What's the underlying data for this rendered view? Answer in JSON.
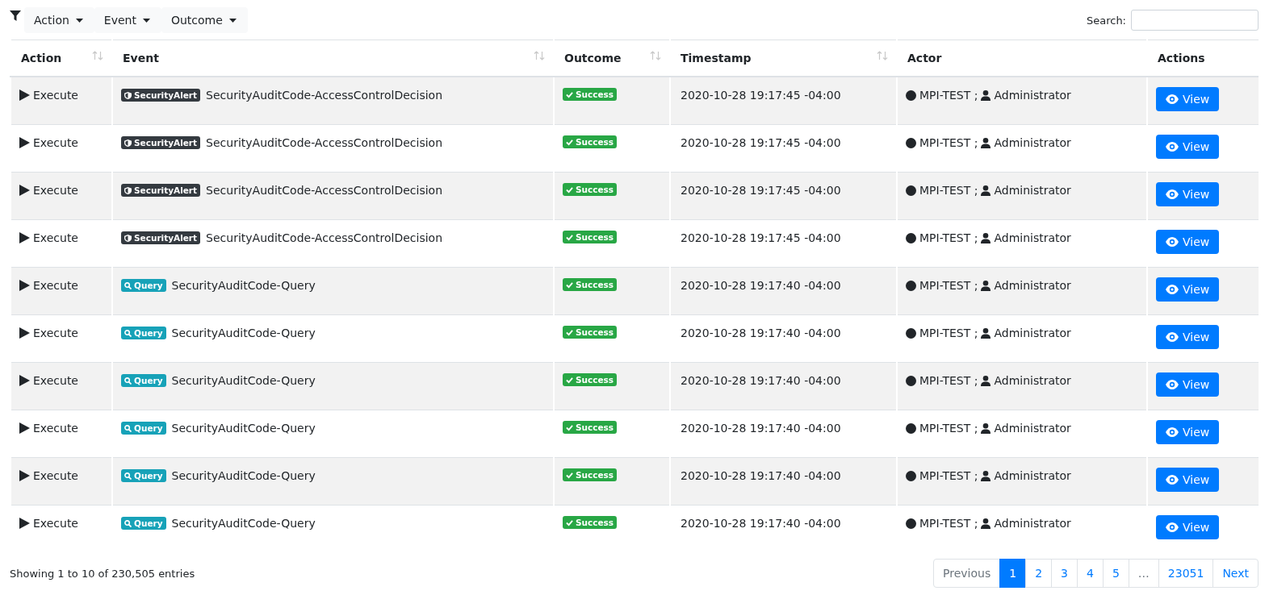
{
  "filters": [
    {
      "label": "Action"
    },
    {
      "label": "Event"
    },
    {
      "label": "Outcome"
    }
  ],
  "search": {
    "label": "Search:"
  },
  "table": {
    "columns": [
      {
        "label": "Action",
        "sortable": true
      },
      {
        "label": "Event",
        "sortable": true
      },
      {
        "label": "Outcome",
        "sortable": true
      },
      {
        "label": "Timestamp",
        "sortable": true
      },
      {
        "label": "Actor",
        "sortable": false
      },
      {
        "label": "Actions",
        "sortable": false
      }
    ],
    "rows": [
      {
        "action": "Execute",
        "badge": {
          "kind": "alert",
          "label": "SecurityAlert"
        },
        "event": "SecurityAuditCode-AccessControlDecision",
        "outcome": "Success",
        "timestamp": "2020-10-28 19:17:45 -04:00",
        "device": "MPI-TEST ;",
        "user": "Administrator",
        "button": "View"
      },
      {
        "action": "Execute",
        "badge": {
          "kind": "alert",
          "label": "SecurityAlert"
        },
        "event": "SecurityAuditCode-AccessControlDecision",
        "outcome": "Success",
        "timestamp": "2020-10-28 19:17:45 -04:00",
        "device": "MPI-TEST ;",
        "user": "Administrator",
        "button": "View"
      },
      {
        "action": "Execute",
        "badge": {
          "kind": "alert",
          "label": "SecurityAlert"
        },
        "event": "SecurityAuditCode-AccessControlDecision",
        "outcome": "Success",
        "timestamp": "2020-10-28 19:17:45 -04:00",
        "device": "MPI-TEST ;",
        "user": "Administrator",
        "button": "View"
      },
      {
        "action": "Execute",
        "badge": {
          "kind": "alert",
          "label": "SecurityAlert"
        },
        "event": "SecurityAuditCode-AccessControlDecision",
        "outcome": "Success",
        "timestamp": "2020-10-28 19:17:45 -04:00",
        "device": "MPI-TEST ;",
        "user": "Administrator",
        "button": "View"
      },
      {
        "action": "Execute",
        "badge": {
          "kind": "query",
          "label": "Query"
        },
        "event": "SecurityAuditCode-Query",
        "outcome": "Success",
        "timestamp": "2020-10-28 19:17:40 -04:00",
        "device": "MPI-TEST ;",
        "user": "Administrator",
        "button": "View"
      },
      {
        "action": "Execute",
        "badge": {
          "kind": "query",
          "label": "Query"
        },
        "event": "SecurityAuditCode-Query",
        "outcome": "Success",
        "timestamp": "2020-10-28 19:17:40 -04:00",
        "device": "MPI-TEST ;",
        "user": "Administrator",
        "button": "View"
      },
      {
        "action": "Execute",
        "badge": {
          "kind": "query",
          "label": "Query"
        },
        "event": "SecurityAuditCode-Query",
        "outcome": "Success",
        "timestamp": "2020-10-28 19:17:40 -04:00",
        "device": "MPI-TEST ;",
        "user": "Administrator",
        "button": "View"
      },
      {
        "action": "Execute",
        "badge": {
          "kind": "query",
          "label": "Query"
        },
        "event": "SecurityAuditCode-Query",
        "outcome": "Success",
        "timestamp": "2020-10-28 19:17:40 -04:00",
        "device": "MPI-TEST ;",
        "user": "Administrator",
        "button": "View"
      },
      {
        "action": "Execute",
        "badge": {
          "kind": "query",
          "label": "Query"
        },
        "event": "SecurityAuditCode-Query",
        "outcome": "Success",
        "timestamp": "2020-10-28 19:17:40 -04:00",
        "device": "MPI-TEST ;",
        "user": "Administrator",
        "button": "View"
      },
      {
        "action": "Execute",
        "badge": {
          "kind": "query",
          "label": "Query"
        },
        "event": "SecurityAuditCode-Query",
        "outcome": "Success",
        "timestamp": "2020-10-28 19:17:40 -04:00",
        "device": "MPI-TEST ;",
        "user": "Administrator",
        "button": "View"
      }
    ]
  },
  "info": "Showing 1 to 10 of 230,505 entries",
  "pagination": [
    {
      "label": "Previous",
      "selected": false,
      "disabled": true
    },
    {
      "label": "1",
      "selected": true,
      "disabled": false
    },
    {
      "label": "2",
      "selected": false,
      "disabled": false
    },
    {
      "label": "3",
      "selected": false,
      "disabled": false
    },
    {
      "label": "4",
      "selected": false,
      "disabled": false
    },
    {
      "label": "5",
      "selected": false,
      "disabled": false
    },
    {
      "label": "…",
      "selected": false,
      "disabled": true
    },
    {
      "label": "23051",
      "selected": false,
      "disabled": false
    },
    {
      "label": "Next",
      "selected": false,
      "disabled": false
    }
  ]
}
